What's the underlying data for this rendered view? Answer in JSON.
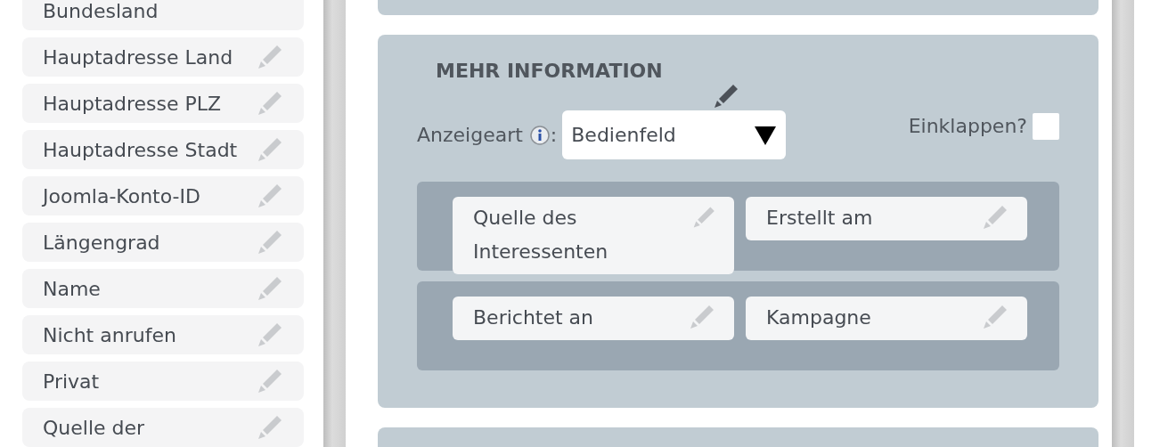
{
  "sidebar": {
    "items": [
      {
        "label": "Bundesland",
        "edit_icon": false
      },
      {
        "label": "Hauptadresse Land",
        "edit_icon": true
      },
      {
        "label": "Hauptadresse PLZ",
        "edit_icon": true
      },
      {
        "label": "Hauptadresse Stadt",
        "edit_icon": true
      },
      {
        "label": "Joomla-Konto-ID",
        "edit_icon": true
      },
      {
        "label": "Längengrad",
        "edit_icon": true
      },
      {
        "label": "Name",
        "edit_icon": true
      },
      {
        "label": "Nicht anrufen",
        "edit_icon": true
      },
      {
        "label": "Privat",
        "edit_icon": true
      },
      {
        "label": "Quelle der",
        "edit_icon": true
      }
    ]
  },
  "panel": {
    "title": "MEHR INFORMATION",
    "display_label": "Anzeigeart",
    "colon": ":",
    "display_value": "Bedienfeld",
    "collapse_label": "Einklappen?",
    "collapse_checked": false,
    "rows": [
      {
        "fields": [
          "Quelle des Interessenten",
          "Erstellt am"
        ]
      },
      {
        "fields": [
          "Berichtet an",
          "Kampagne"
        ]
      }
    ]
  }
}
